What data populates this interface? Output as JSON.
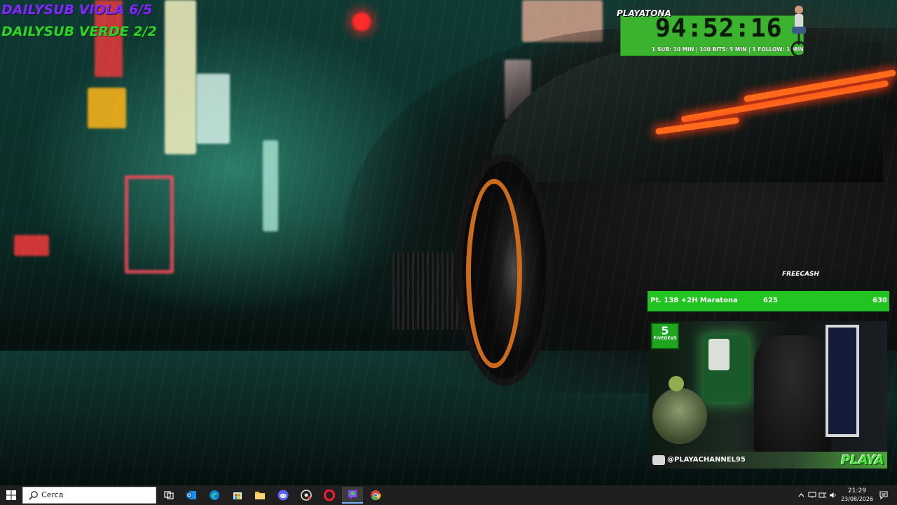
{
  "overlay": {
    "subs": {
      "viola": "DAILYSUB VIOLA 6/5",
      "verde": "DAILYSUB VERDE 2/2"
    },
    "timer": {
      "brand": "PLAYATONA",
      "value": "94:52:16",
      "rules": "1 SUB: 10 MIN | 100 BITS: 5 MIN | 1 FOLLOW: 1 MIN"
    },
    "freecash": "FREECASH",
    "goal": {
      "label": "Pt. 138 +2H Maratona",
      "current": "625",
      "target": "630"
    },
    "webcam": {
      "badge_number": "5",
      "badge_text": "FIVEDEVS",
      "handle": "@PLAYACHANNEL95",
      "brand": "PLAYA"
    }
  },
  "taskbar": {
    "search_placeholder": "Cerca",
    "apps": [
      {
        "name": "task-view-icon",
        "color": "#ffffff"
      },
      {
        "name": "outlook-icon",
        "color": "#1a8cf0"
      },
      {
        "name": "edge-icon",
        "color": "#2ec4a4"
      },
      {
        "name": "store-icon",
        "color": "#ffffff"
      },
      {
        "name": "file-explorer-icon",
        "color": "#f2c14e"
      },
      {
        "name": "discord-icon",
        "color": "#5865f2"
      },
      {
        "name": "streamlabs-icon",
        "color": "#e6e6e6"
      },
      {
        "name": "opera-icon",
        "color": "#ff1b2d"
      },
      {
        "name": "twitch-studio-icon",
        "color": "#9146ff"
      },
      {
        "name": "chrome-icon",
        "color": "#4caf50"
      }
    ],
    "clock": {
      "time": "21:29",
      "date": "23/08/2026"
    }
  },
  "colors": {
    "taskbar_bg": "#1f1f1f",
    "goal_green": "#22c422",
    "timer_green": "#3cb32f",
    "sub_purple": "#7b2cf5",
    "sub_green": "#2fd12a"
  }
}
